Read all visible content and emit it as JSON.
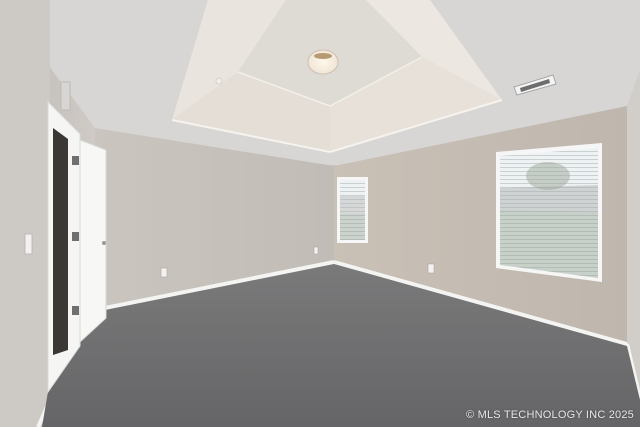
{
  "watermark": "© MLS TECHNOLOGY INC 2025",
  "colors": {
    "wall": "#c8c2bc",
    "ceiling": "#d9d8d6",
    "tray": "#e6e1da",
    "carpet": "#6e6d6e",
    "trim": "#f3f3f2",
    "window_light": "#e9eef0"
  },
  "elements": {
    "ceiling_light": "flush-mount-light",
    "vent": "ceiling-air-vent",
    "door": "open-interior-door",
    "window_left": "small-window-with-blinds",
    "window_right": "large-window-with-blinds"
  }
}
